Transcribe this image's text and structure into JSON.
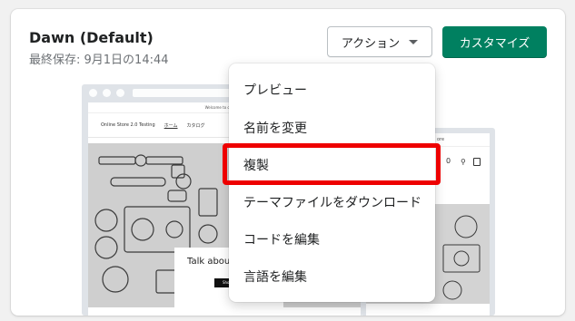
{
  "theme": {
    "name": "Dawn (Default)",
    "last_saved": "最終保存: 9月1日の14:44"
  },
  "buttons": {
    "actions_label": "アクション",
    "customize_label": "カスタマイズ"
  },
  "preview": {
    "announcement": "Welcome to our store",
    "store_name": "Online Store 2.0 Testing",
    "nav_items": [
      "ホーム",
      "カタログ"
    ],
    "hero_heading": "Talk about y",
    "hero_button": "Shop",
    "mobile_announcement": "ore",
    "mobile_cart_count": "0"
  },
  "menu": {
    "items": [
      {
        "label": "プレビュー"
      },
      {
        "label": "名前を変更"
      },
      {
        "label": "複製"
      },
      {
        "label": "テーマファイルをダウンロード"
      },
      {
        "label": "コードを編集"
      },
      {
        "label": "言語を編集"
      }
    ],
    "highlighted_item": "複製"
  },
  "colors": {
    "primary": "#008060",
    "highlight_border": "#ee0000"
  }
}
